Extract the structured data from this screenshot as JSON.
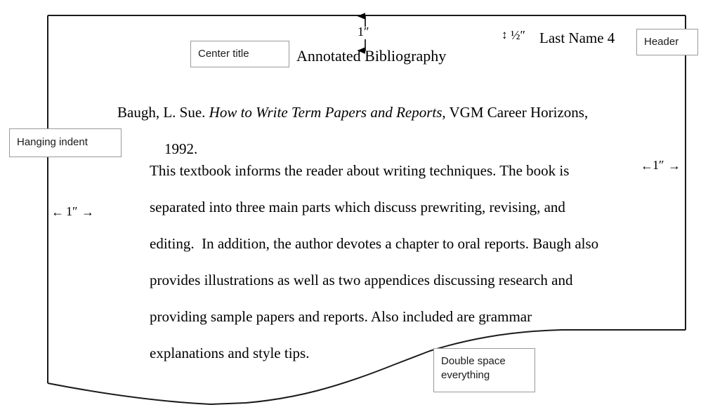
{
  "document": {
    "title": "Annotated Bibliography",
    "header_text": "Last Name 4",
    "entry_lines": [
      {
        "prefix": "Baugh, L. Sue. ",
        "italic": "How to Write Term Papers and Reports",
        "suffix": ", VGM Career Horizons,"
      },
      {
        "prefix": "1992.",
        "italic": "",
        "suffix": ""
      }
    ],
    "annotation_paragraph": [
      "This textbook informs the reader about writing techniques. The book is",
      "separated into three main parts which discuss prewriting, revising, and",
      "editing.  In addition, the author devotes a chapter to oral reports. Baugh also",
      "provides illustrations as well as two appendices discussing research and",
      "providing sample papers and reports. Also included are grammar",
      "explanations and style tips."
    ]
  },
  "callouts": {
    "center_title": "Center title",
    "header": "Header",
    "hanging_indent": "Hanging indent",
    "double_space_line1": "Double space",
    "double_space_line2": "everything"
  },
  "measurements": {
    "top_margin": "1″",
    "header_margin": "½″",
    "left_margin": "1″",
    "right_margin": "1″",
    "left_arrow_glyph": "←",
    "right_arrow_glyph": "→",
    "updown_arrow_glyph": "↕"
  },
  "colors": {
    "page_outline": "#1a1a1a",
    "callout_border": "#9a9a9a",
    "text": "#000000",
    "background": "#ffffff"
  }
}
